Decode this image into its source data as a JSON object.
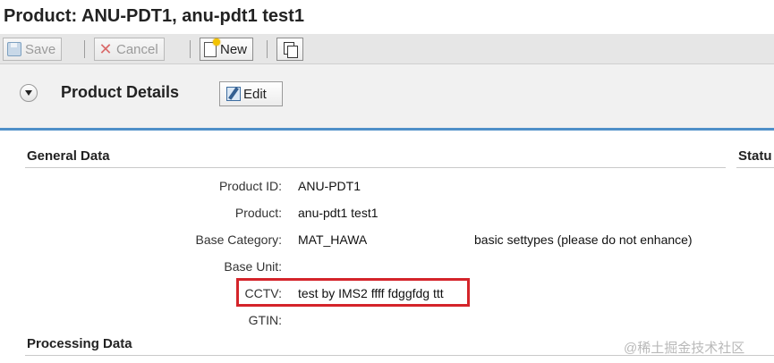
{
  "page": {
    "title": "Product: ANU-PDT1, anu-pdt1 test1"
  },
  "toolbar": {
    "save_label": "Save",
    "cancel_label": "Cancel",
    "new_label": "New"
  },
  "details": {
    "title": "Product Details",
    "edit_label": "Edit"
  },
  "sections": {
    "general": "General Data",
    "status": "Statu",
    "processing": "Processing Data"
  },
  "fields": [
    {
      "label": "Product ID:",
      "value": "ANU-PDT1",
      "desc": ""
    },
    {
      "label": "Product:",
      "value": "anu-pdt1 test1",
      "desc": ""
    },
    {
      "label": "Base Category:",
      "value": "MAT_HAWA",
      "desc": "basic settypes (please do not enhance)"
    },
    {
      "label": "Base Unit:",
      "value": "",
      "desc": ""
    },
    {
      "label": "CCTV:",
      "value": "test by IMS2 ffff fdggfdg ttt",
      "desc": ""
    },
    {
      "label": "GTIN:",
      "value": "",
      "desc": ""
    }
  ],
  "watermark": "@稀土掘金技术社区",
  "colors": {
    "accent_rule": "#4f8fc8",
    "highlight": "#d4242a"
  }
}
